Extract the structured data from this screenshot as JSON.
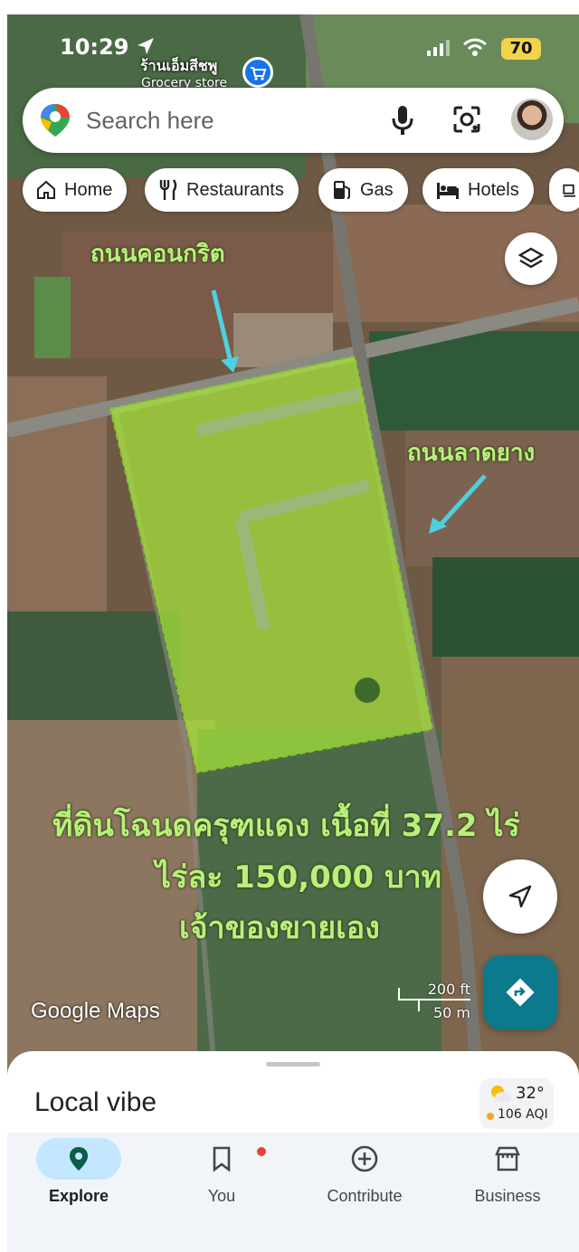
{
  "status_bar": {
    "time": "10:29",
    "battery": "70"
  },
  "map_poi": {
    "name": "ร้านเอ็มสีชพู",
    "category": "Grocery store"
  },
  "search": {
    "placeholder": "Search here"
  },
  "chips": [
    {
      "label": "Home",
      "icon": "home-icon"
    },
    {
      "label": "Restaurants",
      "icon": "fork-knife-icon"
    },
    {
      "label": "Gas",
      "icon": "gas-pump-icon"
    },
    {
      "label": "Hotels",
      "icon": "bed-icon"
    }
  ],
  "annotations": {
    "concrete_road": "ถนนคอนกริต",
    "asphalt_road": "ถนนลาดยาง",
    "line1": "ที่ดินโฉนดครุฑแดง เนื้อที่ 37.2 ไร่",
    "line2": "ไร่ละ 150,000 บาท",
    "line3": "เจ้าของขายเอง"
  },
  "map_footer": {
    "logo": "Google Maps",
    "scale_ft": "200 ft",
    "scale_m": "50 m"
  },
  "sheet": {
    "title": "Local vibe",
    "temperature": "32°",
    "aqi": "106 AQI"
  },
  "bottom_nav": [
    {
      "label": "Explore",
      "icon": "location-pin-icon",
      "active": true
    },
    {
      "label": "You",
      "icon": "bookmark-icon",
      "active": false
    },
    {
      "label": "Contribute",
      "icon": "plus-circle-icon",
      "active": false
    },
    {
      "label": "Business",
      "icon": "storefront-icon",
      "active": false
    }
  ],
  "colors": {
    "accent": "#0b7a8c",
    "plot_fill": "#a8e63a",
    "annotation_text": "#b8f07a",
    "arrow": "#4fd0e0"
  }
}
